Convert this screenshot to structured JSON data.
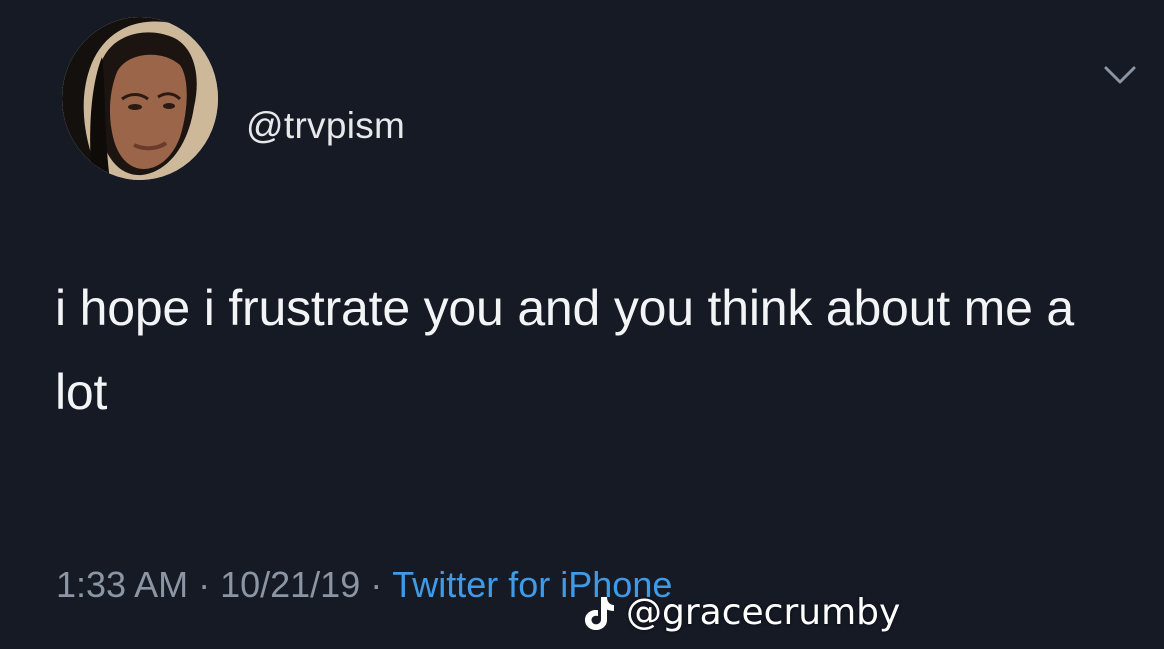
{
  "tweet": {
    "handle": "@trvpism",
    "text": "i hope i frustrate you and you think about me a lot",
    "time": "1:33 AM",
    "separator": "·",
    "date": "10/21/19",
    "source": "Twitter for iPhone"
  },
  "icons": {
    "avatar": "profile-photo",
    "menu": "chevron-down-icon",
    "watermark": "tiktok-icon"
  },
  "watermark": {
    "handle": "@gracecrumby"
  },
  "colors": {
    "background": "#151a25",
    "text": "#f3f4f6",
    "meta": "#8b95a3",
    "link": "#3f9ae8"
  }
}
